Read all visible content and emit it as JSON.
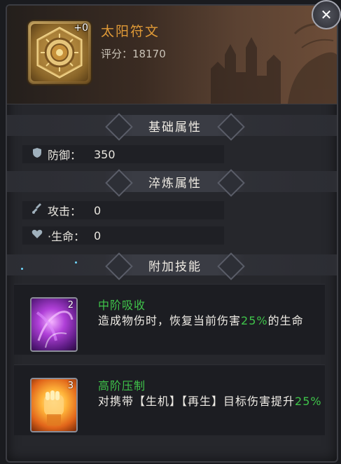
{
  "item": {
    "name": "太阳符文",
    "enhance": "+0",
    "score_label": "评分：",
    "score_value": "18170"
  },
  "close": {
    "icon": "close-icon"
  },
  "sections": {
    "base": "基础属性",
    "temper": "淬炼属性",
    "skills": "附加技能"
  },
  "base_stats": [
    {
      "icon": "shield-icon",
      "label": "防御：",
      "value": "350"
    }
  ],
  "temper_stats": [
    {
      "icon": "sword-icon",
      "label": "攻击：",
      "value": "0"
    },
    {
      "icon": "heart-icon",
      "label": "·生命：",
      "value": "0"
    }
  ],
  "skills": [
    {
      "level": "2",
      "name": "中阶吸收",
      "desc_a": "造成物伤时，恢复当前伤害",
      "desc_hl": "25%",
      "desc_b": "的生命",
      "highlight_color": "#3fc34a"
    },
    {
      "level": "3",
      "name": "高阶压制",
      "desc_a": "对携带【生机】【再生】目标伤害提升",
      "desc_hl": "25%",
      "desc_b": "",
      "highlight_color": "#3fc34a"
    }
  ],
  "colors": {
    "title": "#e09a37",
    "skill_name": "#3fc34a"
  }
}
